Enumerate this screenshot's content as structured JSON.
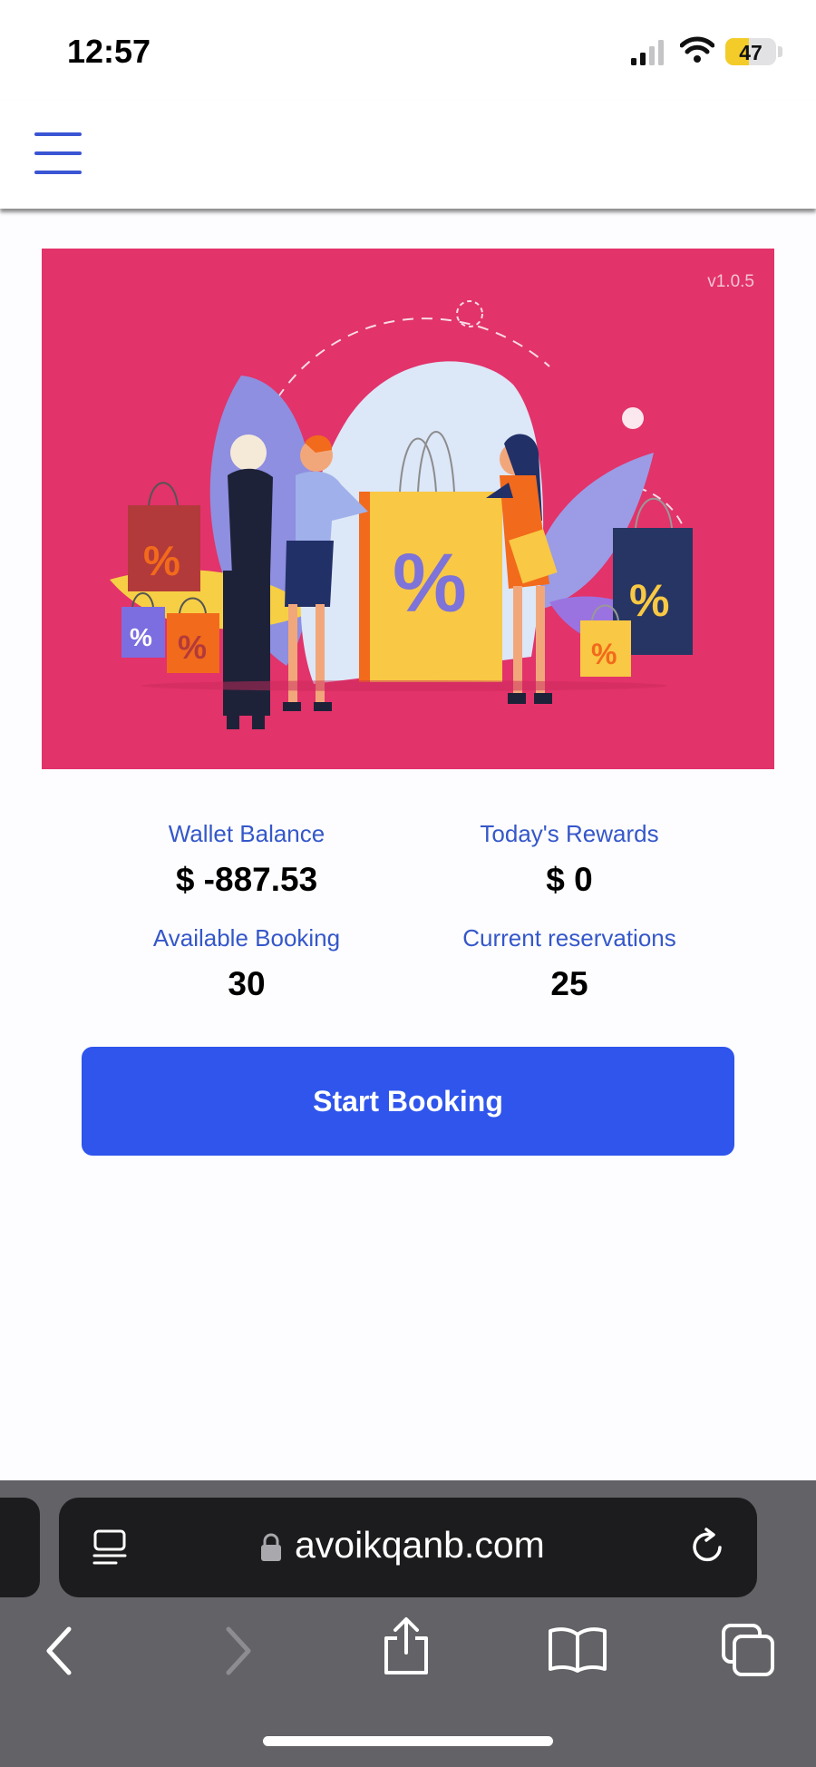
{
  "status_bar": {
    "time": "12:57",
    "battery": "47",
    "battery_level": 0.47,
    "icons": [
      "signal-icon",
      "wifi-icon",
      "battery-icon"
    ]
  },
  "header": {
    "menu_icon": "hamburger-menu-icon"
  },
  "banner": {
    "version": "v1.0.5",
    "background_color": "#e2336a",
    "illustration": "shopping-illustration"
  },
  "stats": {
    "wallet_balance": {
      "label": "Wallet Balance",
      "value": "$ -887.53"
    },
    "todays_rewards": {
      "label": "Today's Rewards",
      "value": "$ 0"
    },
    "available_booking": {
      "label": "Available Booking",
      "value": "30"
    },
    "current_reservations": {
      "label": "Current reservations",
      "value": "25"
    }
  },
  "actions": {
    "start_booking_label": "Start Booking",
    "button_color": "#2f55ec"
  },
  "browser": {
    "url": "avoikqanb.com",
    "icons": [
      "reader-icon",
      "lock-icon",
      "reload-icon",
      "back-icon",
      "forward-icon",
      "share-icon",
      "bookmarks-icon",
      "tabs-icon"
    ]
  }
}
